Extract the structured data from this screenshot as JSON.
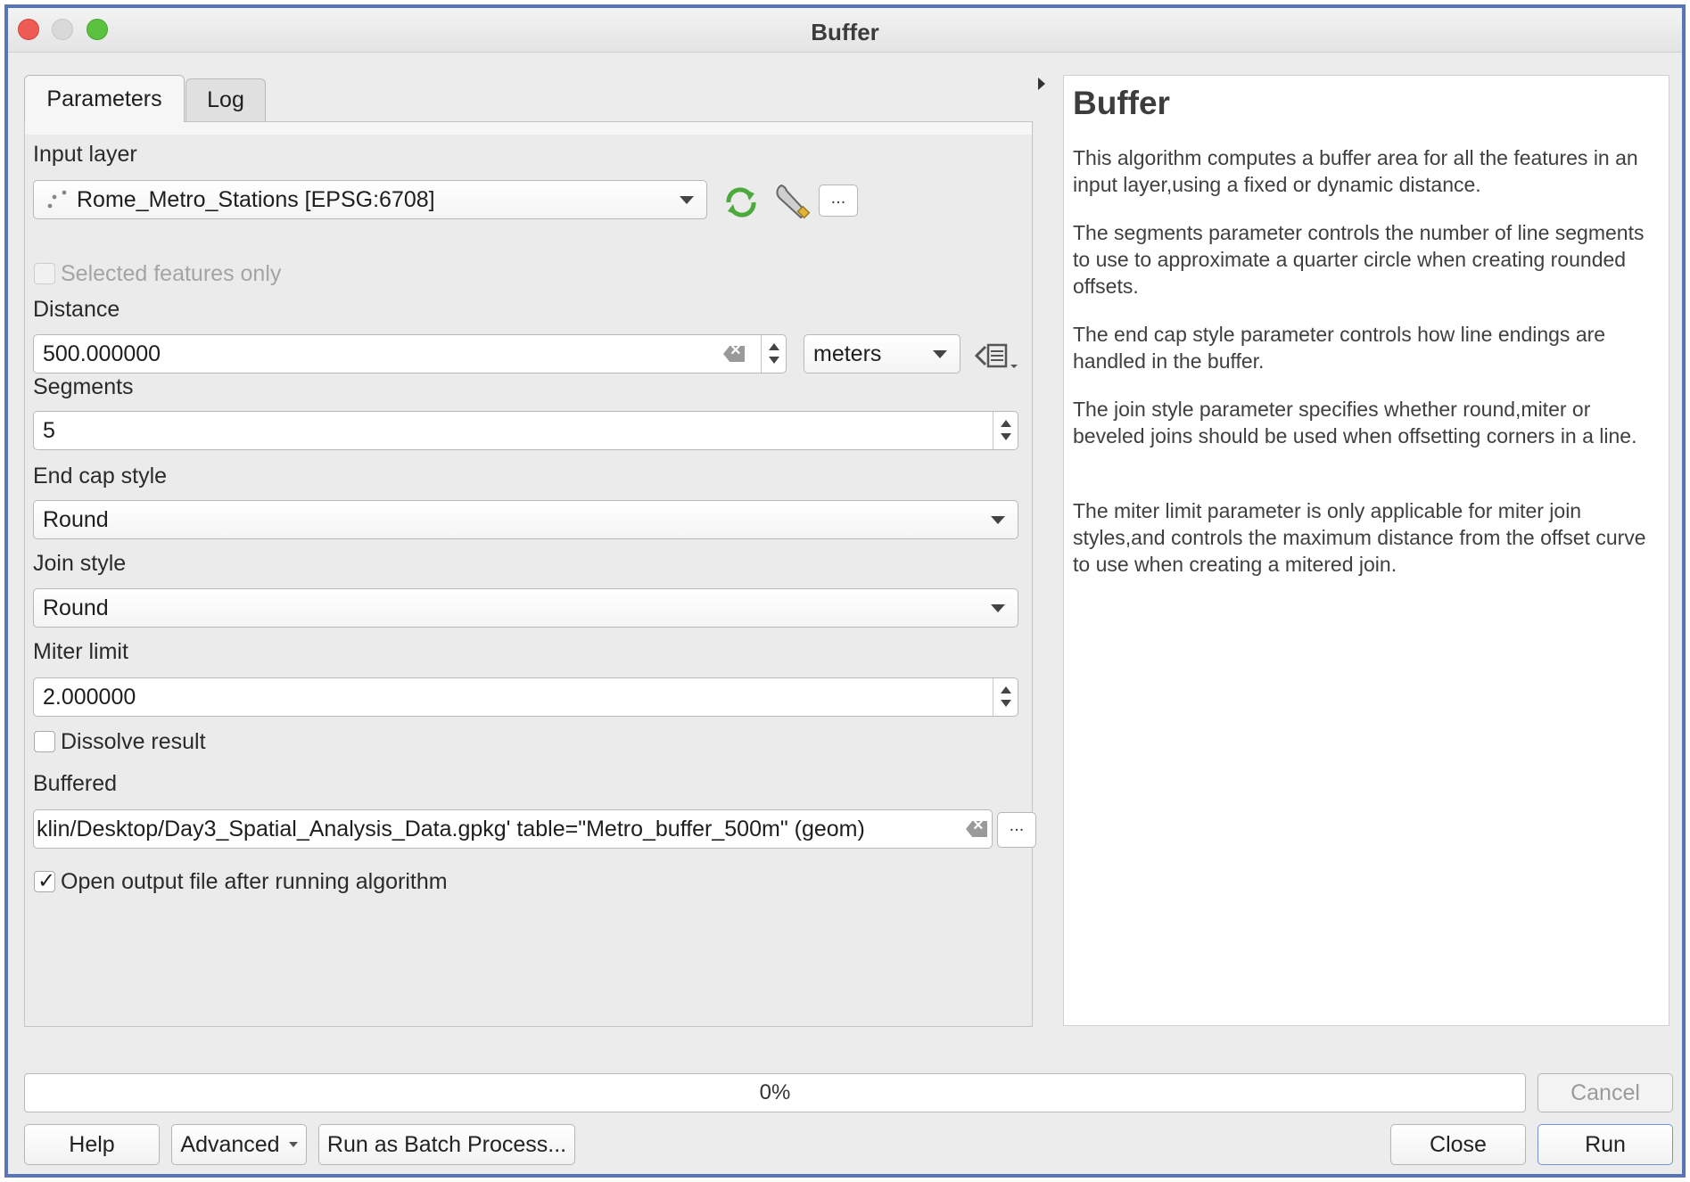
{
  "window": {
    "title": "Buffer"
  },
  "tabs": [
    {
      "label": "Parameters"
    },
    {
      "label": "Log"
    }
  ],
  "params": {
    "input_layer_label": "Input layer",
    "input_layer_value": "Rome_Metro_Stations [EPSG:6708]",
    "selected_only_label": "Selected features only",
    "distance_label": "Distance",
    "distance_value": "500.000000",
    "distance_unit": "meters",
    "segments_label": "Segments",
    "segments_value": "5",
    "end_cap_label": "End cap style",
    "end_cap_value": "Round",
    "join_label": "Join style",
    "join_value": "Round",
    "miter_label": "Miter limit",
    "miter_value": "2.000000",
    "dissolve_label": "Dissolve result",
    "buffered_label": "Buffered",
    "buffered_value": "klin/Desktop/Day3_Spatial_Analysis_Data.gpkg' table=\"Metro_buffer_500m\" (geom)",
    "open_output_label": "Open output file after running algorithm",
    "ellipsis": "..."
  },
  "help": {
    "title": "Buffer",
    "paragraphs": [
      "This algorithm computes a buffer area for all the features in an input layer,using a fixed or dynamic distance.",
      "The segments parameter controls the number of line segments to use to approximate a quarter circle when creating rounded offsets.",
      "The end cap style parameter controls how line endings are handled in the buffer.",
      "The join style parameter specifies whether round,miter or beveled joins should be used when offsetting corners in a line.",
      "The miter limit parameter is only applicable for miter join styles,and controls the maximum distance from the offset curve to use when creating a mitered join."
    ]
  },
  "progress": {
    "text": "0%",
    "value": 0
  },
  "buttons": {
    "cancel": "Cancel",
    "help": "Help",
    "advanced": "Advanced",
    "batch": "Run as Batch Process...",
    "close": "Close",
    "run": "Run"
  },
  "colors": {
    "accent": "#5a74b8",
    "reload_icon": "#4caa3c",
    "run_border": "#6e93d6"
  }
}
